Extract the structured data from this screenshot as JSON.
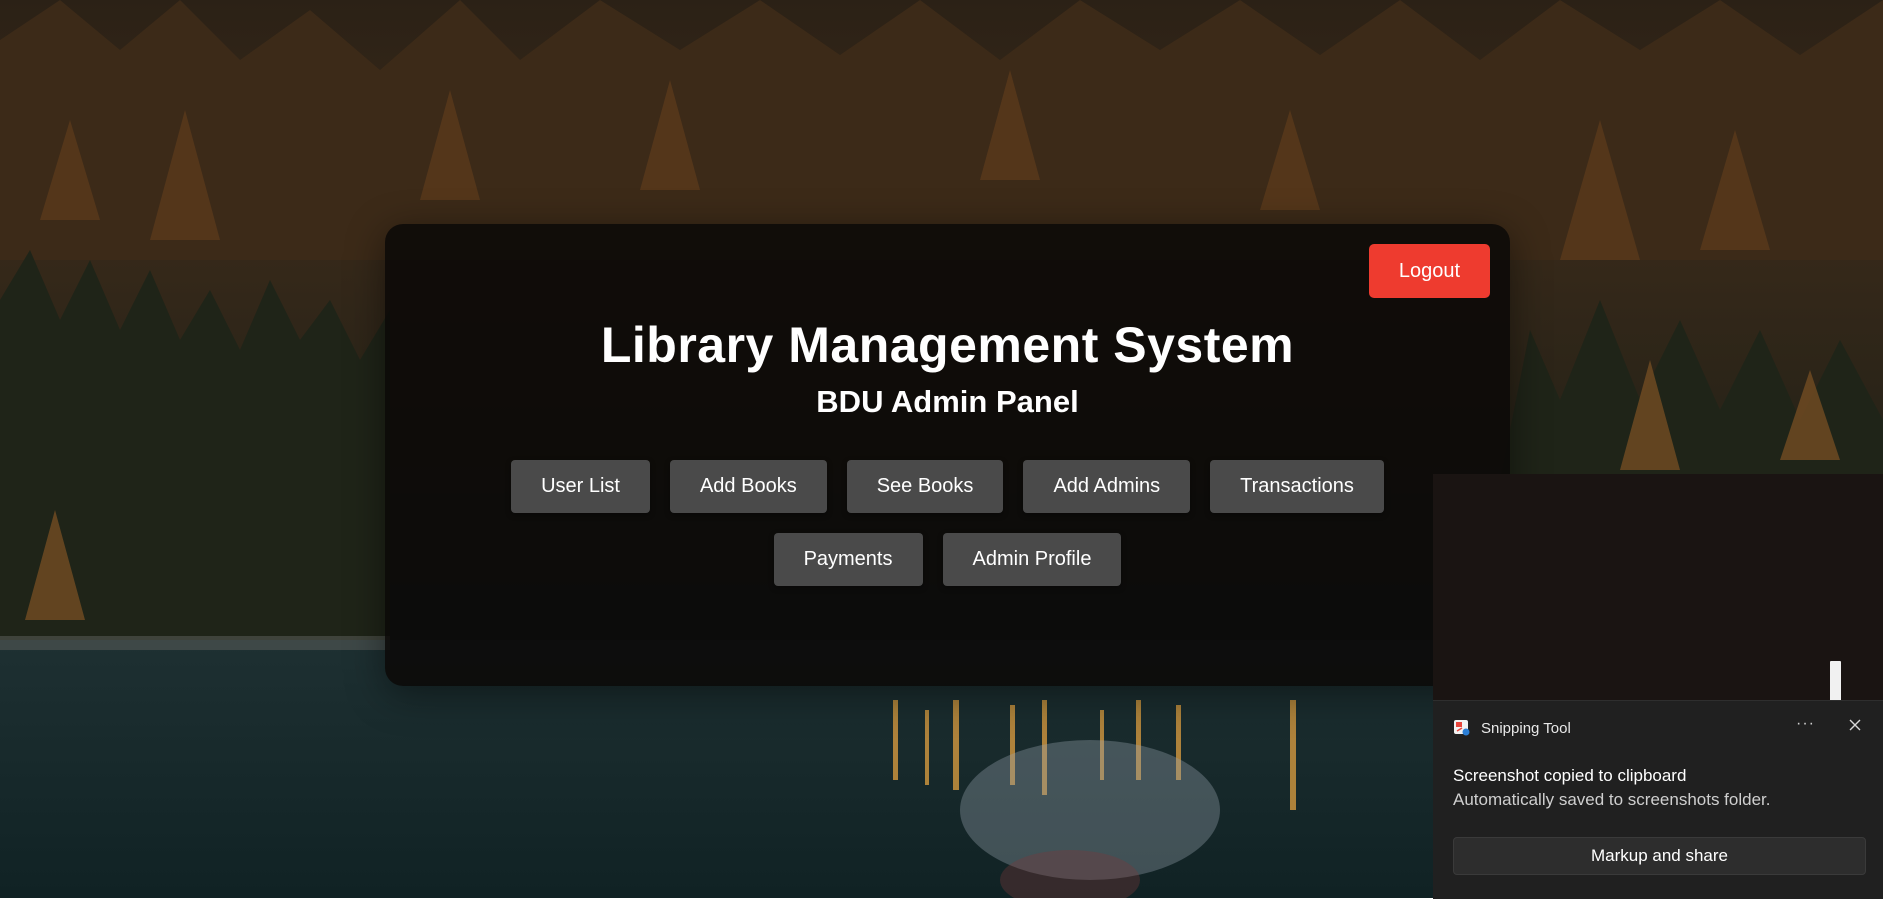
{
  "header": {
    "logout_label": "Logout",
    "title": "Library Management System",
    "subtitle": "BDU Admin Panel"
  },
  "nav": {
    "row1": [
      "User List",
      "Add Books",
      "See Books",
      "Add Admins",
      "Transactions"
    ],
    "row2": [
      "Payments",
      "Admin Profile"
    ]
  },
  "notification": {
    "app_name": "Snipping Tool",
    "more_label": "···",
    "title": "Screenshot copied to clipboard",
    "body": "Automatically saved to screenshots folder.",
    "action_label": "Markup and share"
  },
  "colors": {
    "logout": "#ee3b2f",
    "nav_button": "#4a4a4a",
    "panel": "#0a0807"
  },
  "icons": {
    "app": "snipping-tool-icon",
    "close": "close-icon"
  }
}
